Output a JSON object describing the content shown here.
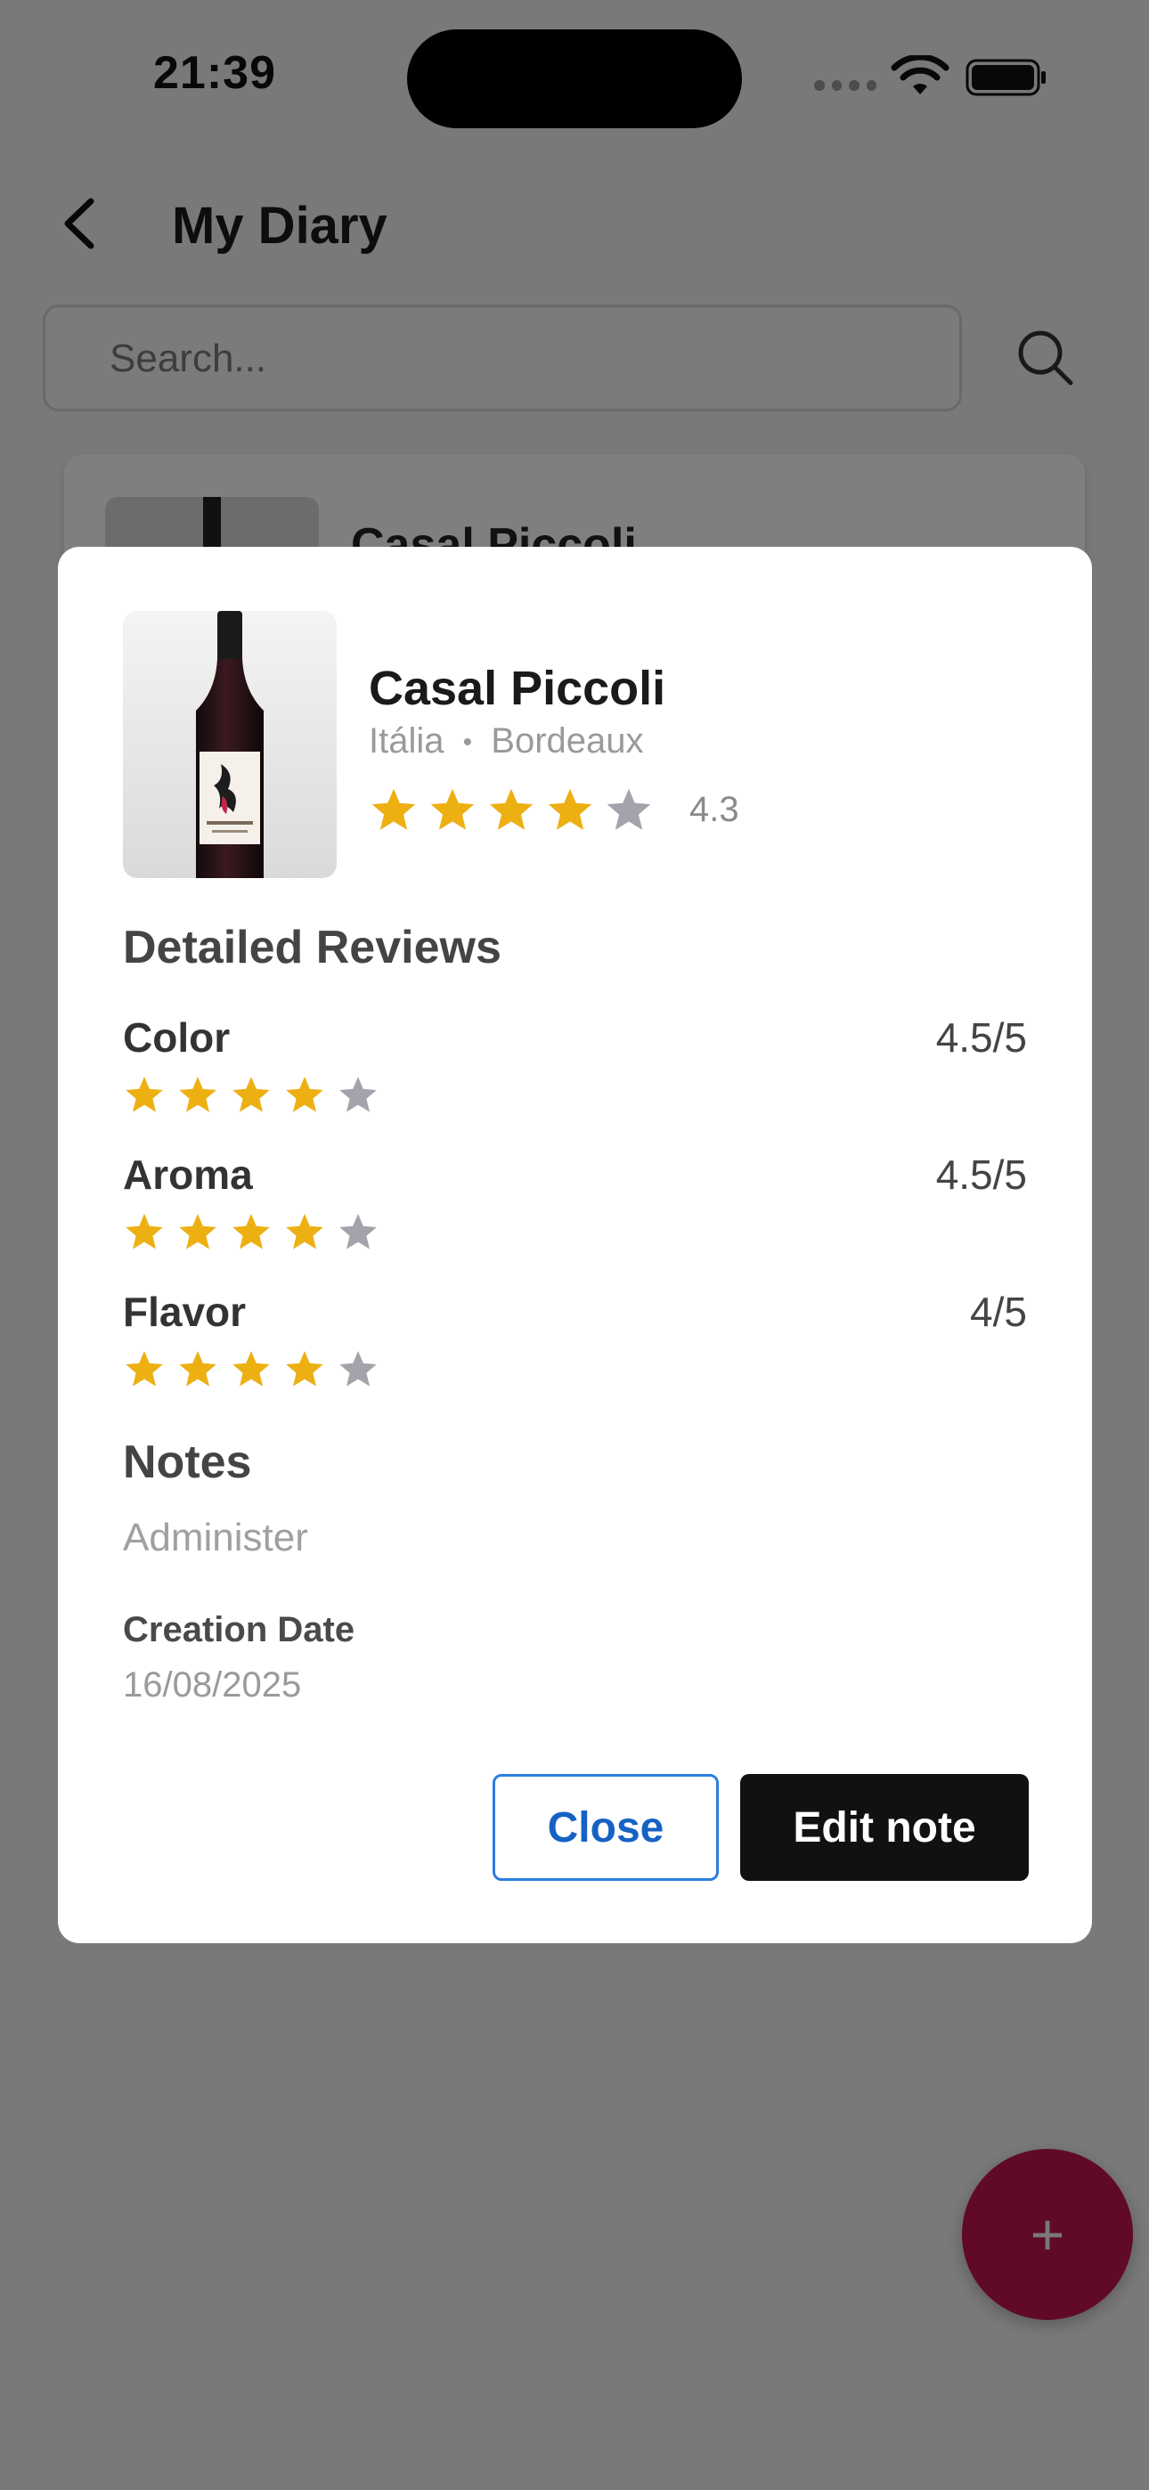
{
  "status_bar": {
    "time": "21:39"
  },
  "nav": {
    "title": "My Diary"
  },
  "search": {
    "placeholder": "Search..."
  },
  "list": {
    "first_card_title": "Casal Piccoli"
  },
  "modal": {
    "wine_name": "Casal Piccoli",
    "country": "Itália",
    "separator": "•",
    "region": "Bordeaux",
    "rating": {
      "value": 4.3,
      "label": "4.3",
      "stars_filled": 4,
      "stars_total": 5
    },
    "detailed_reviews_title": "Detailed Reviews",
    "reviews": [
      {
        "label": "Color",
        "score": "4.5/5",
        "stars_filled": 4,
        "stars_total": 5
      },
      {
        "label": "Aroma",
        "score": "4.5/5",
        "stars_filled": 4,
        "stars_total": 5
      },
      {
        "label": "Flavor",
        "score": "4/5",
        "stars_filled": 4,
        "stars_total": 5
      }
    ],
    "notes_title": "Notes",
    "notes_text": "Administer",
    "creation_date_label": "Creation Date",
    "creation_date": "16/08/2025",
    "close_label": "Close",
    "edit_label": "Edit note"
  },
  "fab": {
    "icon": "plus-icon"
  },
  "colors": {
    "star_filled": "#EDB013",
    "star_empty": "#A3A3AB",
    "accent_fab": "#C2144A",
    "close_border": "#2A7EE0",
    "edit_bg": "#111111"
  }
}
